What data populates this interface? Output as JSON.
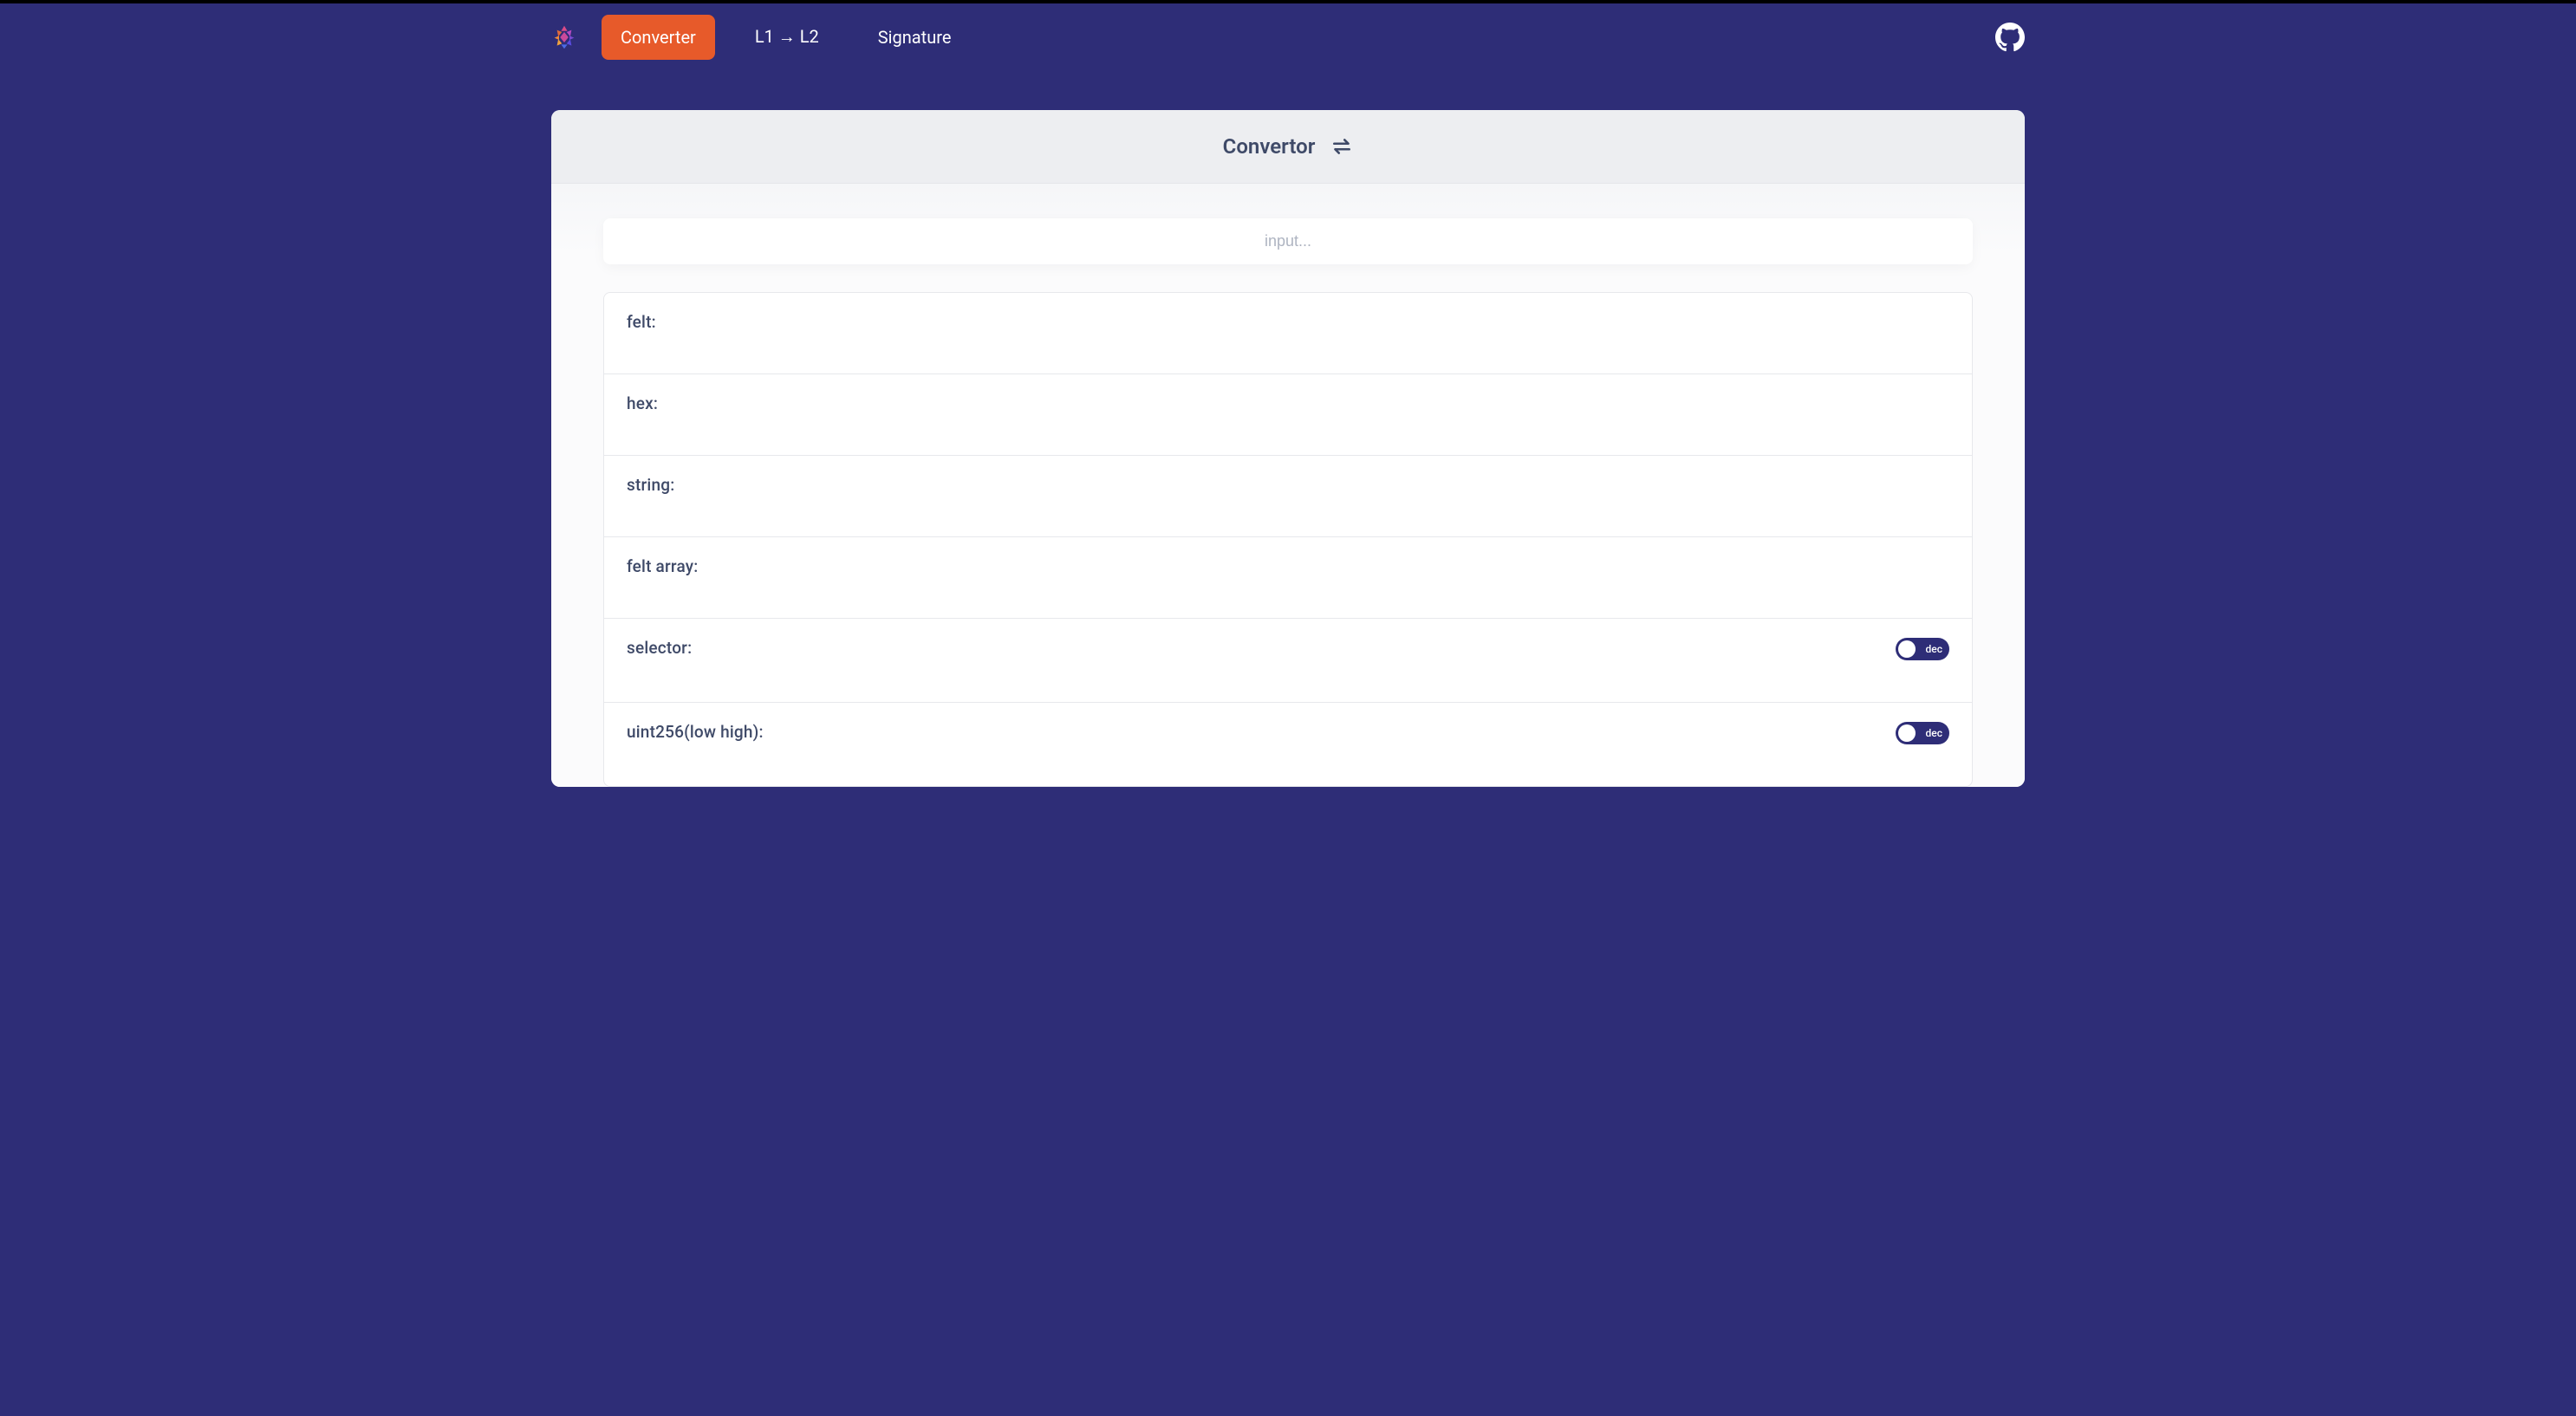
{
  "nav": {
    "tabs": [
      {
        "label": "Converter",
        "active": true
      },
      {
        "label": "L1 → L2",
        "active": false
      },
      {
        "label": "Signature",
        "active": false
      }
    ]
  },
  "card": {
    "title": "Convertor",
    "input": {
      "placeholder": "input...",
      "value": ""
    },
    "rows": [
      {
        "label": "felt:",
        "toggle": null
      },
      {
        "label": "hex:",
        "toggle": null
      },
      {
        "label": "string:",
        "toggle": null
      },
      {
        "label": "felt array:",
        "toggle": null
      },
      {
        "label": "selector:",
        "toggle": {
          "text": "dec"
        }
      },
      {
        "label": "uint256(low high):",
        "toggle": {
          "text": "dec"
        }
      }
    ]
  }
}
